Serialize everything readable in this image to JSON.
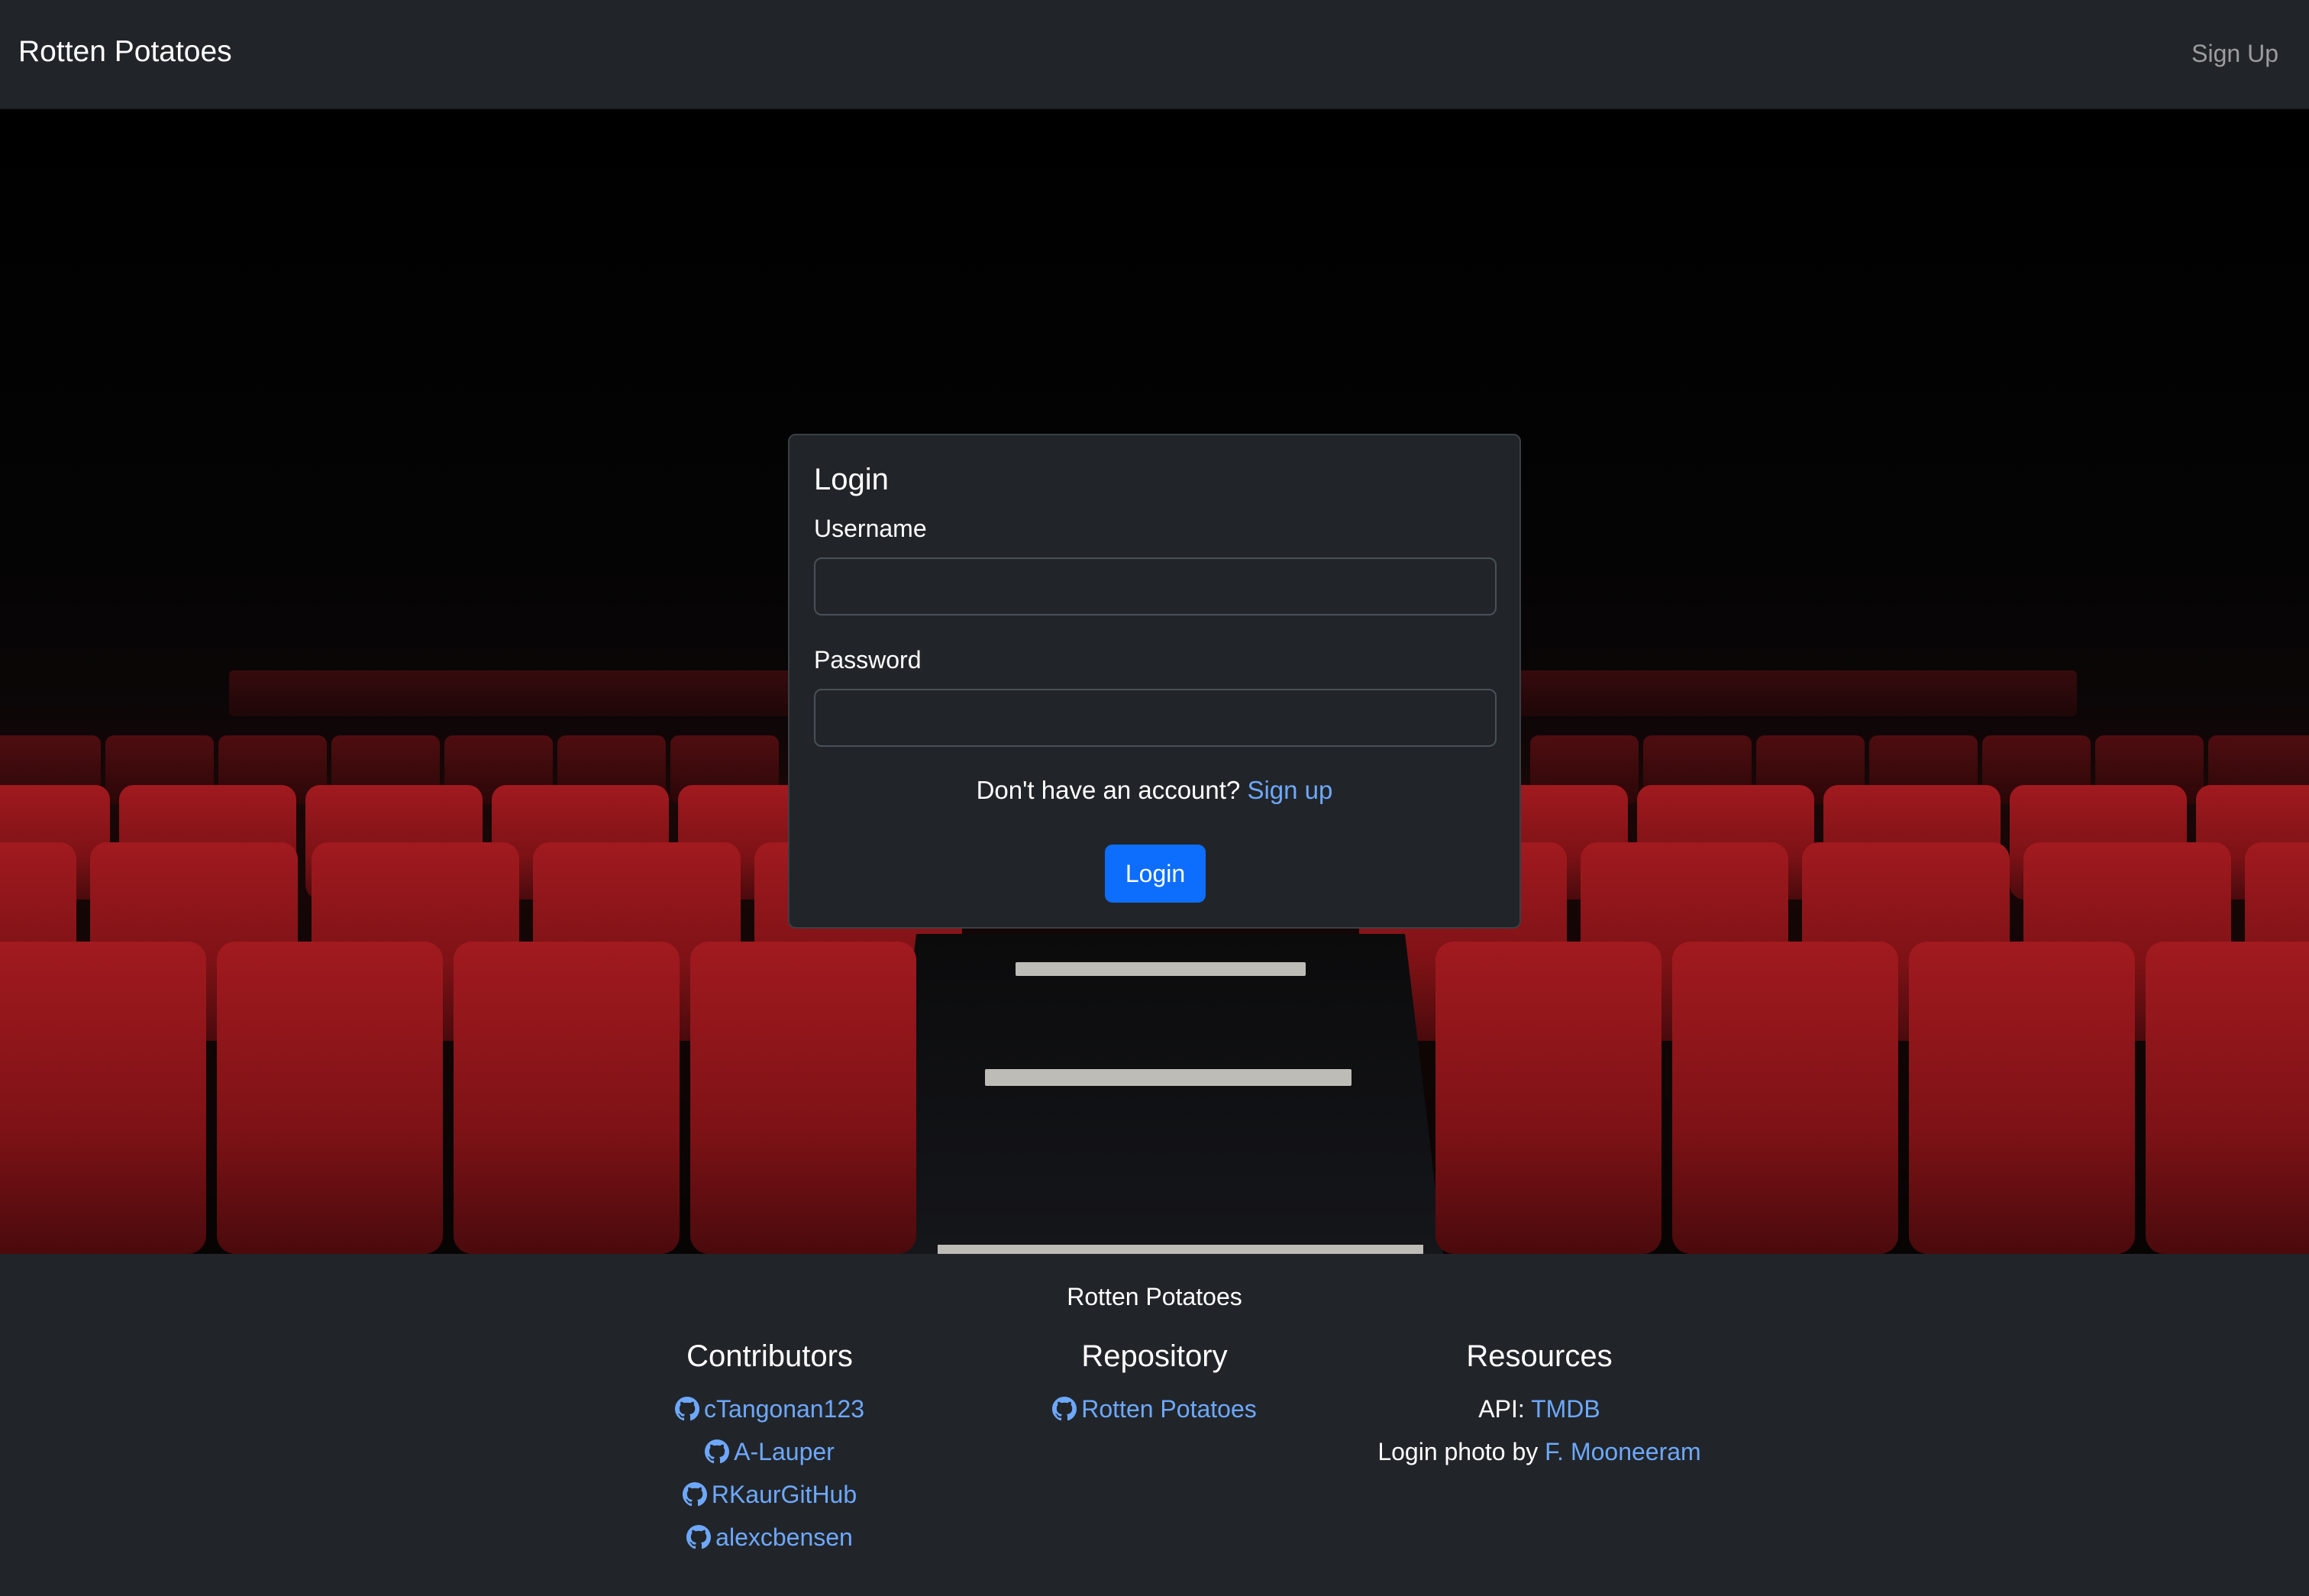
{
  "navbar": {
    "brand": "Rotten Potatoes",
    "signup_link": "Sign Up"
  },
  "login": {
    "title": "Login",
    "username_label": "Username",
    "username_value": "",
    "password_label": "Password",
    "password_value": "",
    "signup_prompt": "Don't have an account?",
    "signup_link": "Sign up",
    "submit_label": "Login"
  },
  "footer": {
    "title": "Rotten Potatoes",
    "contributors": {
      "heading": "Contributors",
      "items": [
        "cTangonan123",
        "A-Lauper",
        "RKaurGitHub",
        "alexcbensen"
      ]
    },
    "repository": {
      "heading": "Repository",
      "items": [
        "Rotten Potatoes"
      ]
    },
    "resources": {
      "heading": "Resources",
      "api_label": "API:",
      "api_link": "TMDB",
      "photo_label": "Login photo by",
      "photo_link": "F. Mooneeram"
    }
  },
  "icons": {
    "contributor_icon": "github-icon",
    "repository_icon": "github-icon"
  },
  "colors": {
    "background": "#212529",
    "link": "#6ea8fe",
    "primary": "#0d6efd",
    "seat_red": "#8e1518"
  }
}
